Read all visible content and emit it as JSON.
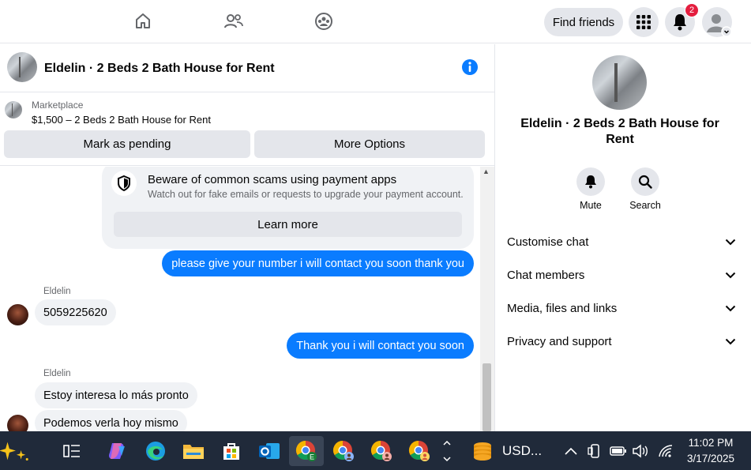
{
  "topnav": {
    "find_friends": "Find friends",
    "notification_count": "2"
  },
  "chat": {
    "title": "Eldelin · 2 Beds 2 Bath House for Rent",
    "marketplace_label": "Marketplace",
    "listing": "$1,500 – 2 Beds 2 Bath House for Rent",
    "mark_pending": "Mark as pending",
    "more_options": "More Options"
  },
  "scam_notice": {
    "title": "Beware of common scams using payment apps",
    "subtitle": "Watch out for fake emails or requests to upgrade your payment account.",
    "learn_more": "Learn more"
  },
  "messages": [
    {
      "from": "me",
      "text": "please give your number i will contact you soon thank you"
    },
    {
      "from": "Eldelin",
      "sender_label": "Eldelin",
      "text": "5059225620"
    },
    {
      "from": "me",
      "text": "Thank you i will contact you soon"
    },
    {
      "from": "Eldelin",
      "sender_label": "Eldelin",
      "text": "Estoy interesa lo más pronto"
    },
    {
      "from": "Eldelin",
      "text": "Podemos verla hoy mismo"
    }
  ],
  "right_panel": {
    "name": "Eldelin · 2 Beds 2 Bath House for Rent",
    "mute": "Mute",
    "search": "Search",
    "rows": [
      "Customise chat",
      "Chat members",
      "Media, files and links",
      "Privacy and support"
    ]
  },
  "taskbar": {
    "widget_text": "USD...",
    "time": "11:02 PM",
    "date": "3/17/2025"
  },
  "colors": {
    "accent": "#0a7cff",
    "badge": "#e41e3f",
    "taskbar": "#202a3a"
  }
}
